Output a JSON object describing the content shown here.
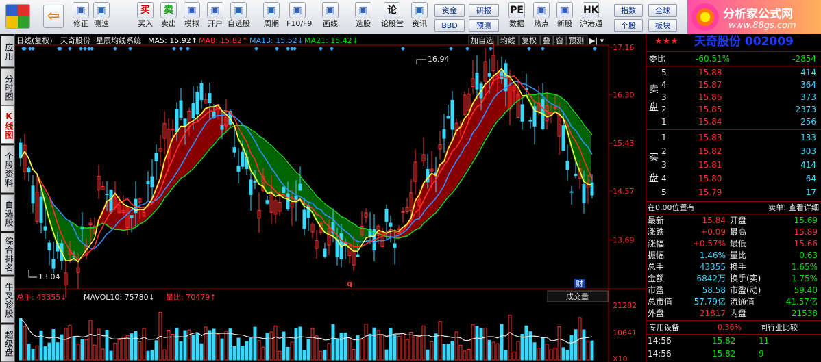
{
  "toolbar": {
    "left_buttons": [
      {
        "label": "修正",
        "icon": "up-down-arrow-icon"
      },
      {
        "label": "测速",
        "icon": "clock-icon"
      },
      {
        "label": "买入",
        "icon": "buy-icon",
        "glyph": "买",
        "color": "#d00000"
      },
      {
        "label": "卖出",
        "icon": "sell-icon",
        "glyph": "卖",
        "color": "#00a000"
      },
      {
        "label": "模拟",
        "icon": "hammer-icon"
      },
      {
        "label": "开户",
        "icon": "lock-icon"
      },
      {
        "label": "自选股",
        "icon": "star-list-icon"
      },
      {
        "label": "周期",
        "icon": "period-icon"
      },
      {
        "label": "F10/F9",
        "icon": "f10-icon"
      },
      {
        "label": "画线",
        "icon": "pencil-icon"
      },
      {
        "label": "选股",
        "icon": "stock-pick-icon"
      },
      {
        "label": "论股堂",
        "icon": "forum-icon",
        "glyph": "论"
      },
      {
        "label": "资讯",
        "icon": "news-icon"
      }
    ],
    "mid_buttons": [
      {
        "label": "资金"
      },
      {
        "label": "研报"
      },
      {
        "label": "BBD"
      },
      {
        "label": "预测"
      }
    ],
    "right_buttons": [
      {
        "label": "数据",
        "icon": "pe-icon",
        "glyph": "PE"
      },
      {
        "label": "热点",
        "icon": "hotspot-icon"
      },
      {
        "label": "新股",
        "icon": "new-stock-icon"
      },
      {
        "label": "沪港通",
        "icon": "hk-connect-icon",
        "glyph": "HK"
      }
    ],
    "far_buttons": [
      {
        "label": "指数"
      },
      {
        "label": "全球"
      },
      {
        "label": "个股"
      },
      {
        "label": "板块"
      }
    ]
  },
  "logo": {
    "title": "分析家公式网",
    "url": "www.88gs.com"
  },
  "left_tabs": [
    {
      "label": "应用",
      "active": false
    },
    {
      "label": "分时图",
      "active": false
    },
    {
      "label": "K线图",
      "active": true
    },
    {
      "label": "个股资料",
      "active": false
    },
    {
      "label": "自选股",
      "active": false
    },
    {
      "label": "综合排名",
      "active": false
    },
    {
      "label": "牛叉诊股",
      "active": false
    },
    {
      "label": "超级盘",
      "active": false
    }
  ],
  "chart_header": {
    "period": "日线(复权)",
    "stock_name": "天奇股份",
    "indicator": "星辰均线系统",
    "ma": [
      {
        "label": "MA5: 15.92",
        "color": "#ffffff",
        "arrow": "up"
      },
      {
        "label": "MA8: 15.82",
        "color": "#ff3030",
        "arrow": "up"
      },
      {
        "label": "MA13: 15.52",
        "color": "#38a8ff",
        "arrow": "down"
      },
      {
        "label": "MA21: 15.42",
        "color": "#00e000",
        "arrow": "down"
      }
    ],
    "menu": [
      "加自选",
      "均线",
      "复权",
      "叠",
      "窗",
      "预测"
    ]
  },
  "chart_data": [
    {
      "type": "candlestick",
      "title": "",
      "ylim": [
        13.04,
        17.16
      ],
      "y_ticks": [
        "17.16",
        "16.30",
        "15.43",
        "14.57",
        "13.69"
      ],
      "annotations": [
        "16.94",
        "13.04",
        "q",
        "财"
      ],
      "colors": {
        "up": "#ff3030",
        "down": "#38d8ff",
        "ma5": "#ffff40",
        "ma8": "#ff3030",
        "ma13": "#3090ff",
        "ma21": "#20d020"
      },
      "series": [
        {
          "name": "",
          "values": []
        }
      ],
      "grid": false
    },
    {
      "type": "bar",
      "title": "",
      "y_ticks": [
        "21282",
        "10641",
        "X10"
      ],
      "ylim": [
        0,
        21282
      ],
      "series": [
        {
          "name": "",
          "values": []
        }
      ]
    }
  ],
  "volume_header": {
    "items": [
      {
        "label": "总手: 43355",
        "color": "#ff3030",
        "arrow": "down"
      },
      {
        "label": "MAVOL10: 75780",
        "color": "#e8e8e8",
        "arrow": "down"
      },
      {
        "label": "量比: 70479",
        "color": "#ff3030",
        "arrow": "up"
      }
    ],
    "button": "成交量"
  },
  "quote": {
    "stars": "★★★",
    "title": "天奇股份 002009",
    "weibi_label": "委比",
    "weibi": "-60.51%",
    "weicha": "-2854",
    "sell_label": "卖盘",
    "buy_label": "买盘",
    "sell": [
      {
        "level": "5",
        "price": "15.88",
        "vol": "414"
      },
      {
        "level": "4",
        "price": "15.87",
        "vol": "364"
      },
      {
        "level": "3",
        "price": "15.86",
        "vol": "373"
      },
      {
        "level": "2",
        "price": "15.85",
        "vol": "2373"
      },
      {
        "level": "1",
        "price": "15.84",
        "vol": "256"
      }
    ],
    "buy": [
      {
        "level": "1",
        "price": "15.83",
        "vol": "133"
      },
      {
        "level": "2",
        "price": "15.82",
        "vol": "303"
      },
      {
        "level": "3",
        "price": "15.81",
        "vol": "414"
      },
      {
        "level": "4",
        "price": "15.80",
        "vol": "64"
      },
      {
        "level": "5",
        "price": "15.79",
        "vol": "17"
      }
    ],
    "status": "在0.00位置有",
    "status_right": "卖单! 查看详细",
    "stats": [
      {
        "l1": "最新",
        "v1": "15.84",
        "l2": "开盘",
        "v2": "15.69"
      },
      {
        "l1": "涨跌",
        "v1": "+0.09",
        "l2": "最高",
        "v2": "15.89"
      },
      {
        "l1": "涨幅",
        "v1": "+0.57%",
        "l2": "最低",
        "v2": "15.66"
      },
      {
        "l1": "振幅",
        "v1": "1.46%",
        "l2": "量比",
        "v2": "0.63"
      },
      {
        "l1": "总手",
        "v1": "43355",
        "l2": "换手",
        "v2": "1.65%"
      },
      {
        "l1": "金额",
        "v1": "6842万",
        "l2": "换手(实)",
        "v2": "1.75%"
      },
      {
        "l1": "市盈",
        "v1": "58.58",
        "l2": "市盈(动)",
        "v2": "59.40"
      },
      {
        "l1": "总市值",
        "v1": "57.79亿",
        "l2": "流通值",
        "v2": "41.57亿"
      },
      {
        "l1": "外盘",
        "v1": "21817",
        "l2": "内盘",
        "v2": "21538"
      }
    ],
    "tabs": [
      {
        "label": "专用设备",
        "value": "0.36%"
      },
      {
        "label": "同行业比较"
      }
    ],
    "ticks": [
      {
        "time": "14:56",
        "price": "15.82",
        "vol": "11"
      },
      {
        "time": "14:56",
        "price": "15.82",
        "vol": "9"
      }
    ]
  }
}
